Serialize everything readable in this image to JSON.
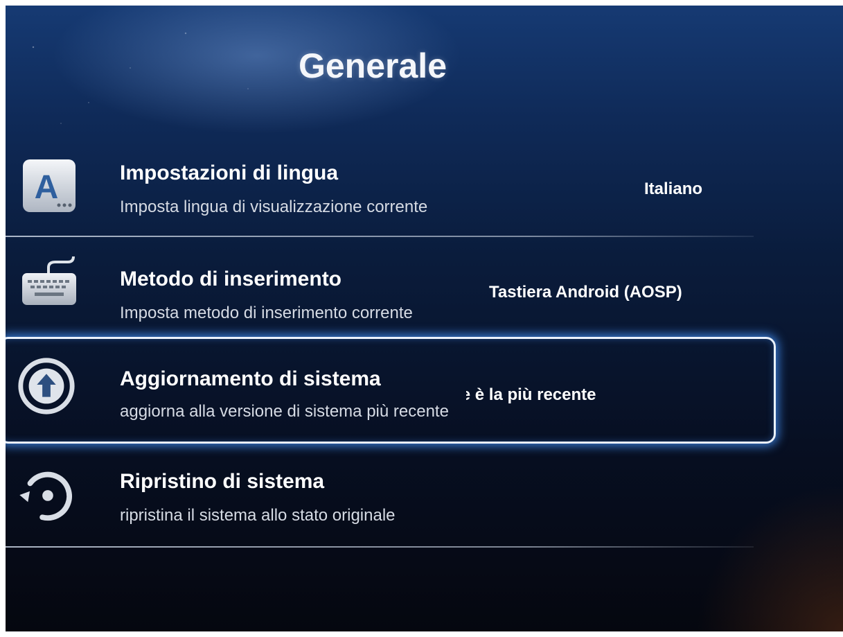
{
  "page": {
    "title": "Generale"
  },
  "items": [
    {
      "label": "Impostazioni di lingua",
      "subtitle": "Imposta lingua di visualizzazione corrente",
      "value": "Italiano",
      "icon": "language-icon"
    },
    {
      "label": "Metodo di inserimento",
      "subtitle": "Imposta metodo di inserimento corrente",
      "value": "Tastiera Android (AOSP)",
      "icon": "keyboard-icon"
    },
    {
      "label": "Aggiornamento di sistema",
      "subtitle": "aggiorna alla versione di sistema più recente",
      "value": "La versione corrente è la più recente",
      "icon": "upload-arrow-icon",
      "selected": true
    },
    {
      "label": "Ripristino di sistema",
      "subtitle": "ripristina il sistema allo stato originale",
      "icon": "restore-icon"
    }
  ],
  "colors": {
    "focus_glow": "#4696ff",
    "text_primary": "#ffffff",
    "text_secondary": "#d6dbe4"
  }
}
